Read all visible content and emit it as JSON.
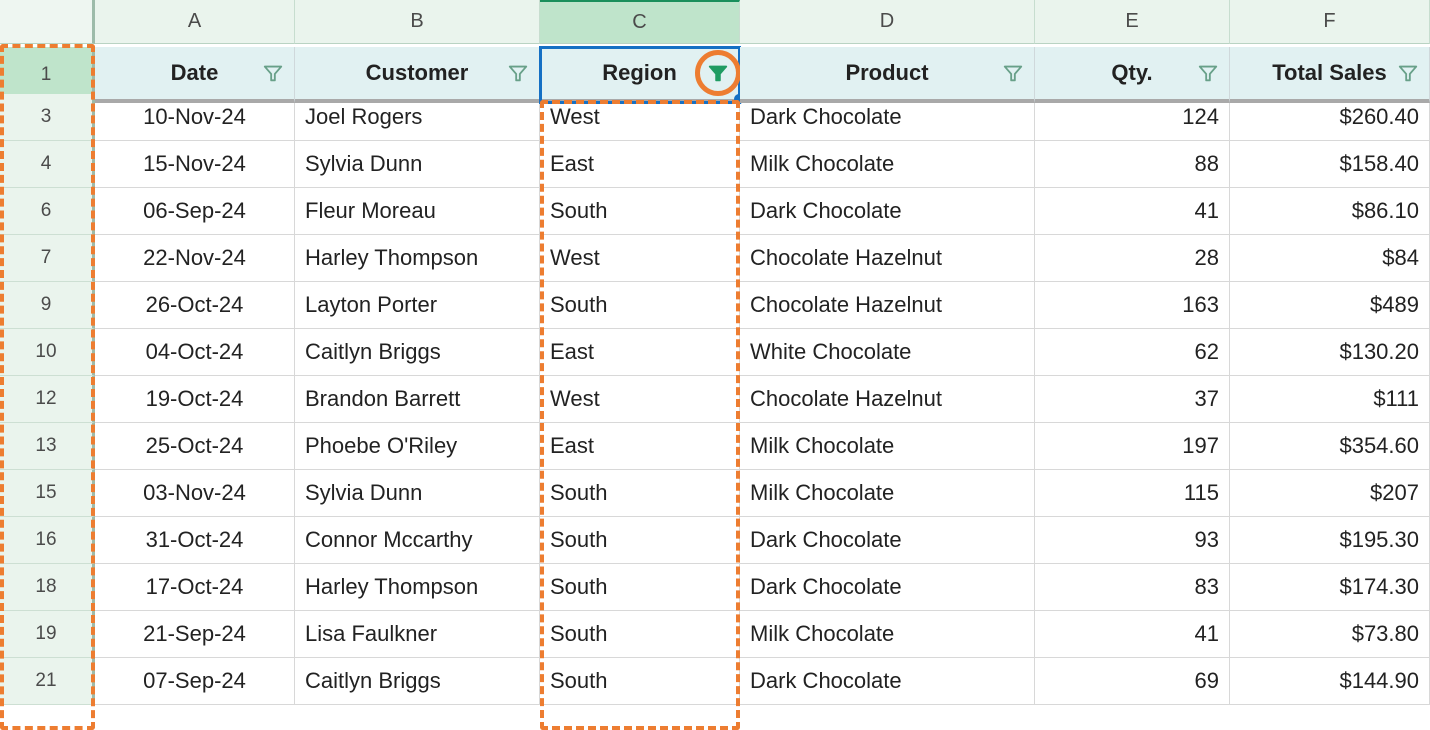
{
  "columns_letters": [
    "A",
    "B",
    "C",
    "D",
    "E",
    "F"
  ],
  "selected_column_index": 2,
  "selected_header": "Region",
  "row_numbers": [
    1,
    3,
    4,
    6,
    7,
    9,
    10,
    12,
    13,
    15,
    16,
    18,
    19,
    21
  ],
  "headers": [
    "Date",
    "Customer",
    "Region",
    "Product",
    "Qty.",
    "Total Sales"
  ],
  "active_filter_index": 2,
  "rows": [
    {
      "date": "10-Nov-24",
      "customer": "Joel Rogers",
      "region": "West",
      "product": "Dark Chocolate",
      "qty": "124",
      "total": "$260.40"
    },
    {
      "date": "15-Nov-24",
      "customer": "Sylvia Dunn",
      "region": "East",
      "product": "Milk Chocolate",
      "qty": "88",
      "total": "$158.40"
    },
    {
      "date": "06-Sep-24",
      "customer": "Fleur Moreau",
      "region": "South",
      "product": "Dark Chocolate",
      "qty": "41",
      "total": "$86.10"
    },
    {
      "date": "22-Nov-24",
      "customer": "Harley Thompson",
      "region": "West",
      "product": "Chocolate Hazelnut",
      "qty": "28",
      "total": "$84"
    },
    {
      "date": "26-Oct-24",
      "customer": "Layton Porter",
      "region": "South",
      "product": "Chocolate Hazelnut",
      "qty": "163",
      "total": "$489"
    },
    {
      "date": "04-Oct-24",
      "customer": "Caitlyn Briggs",
      "region": "East",
      "product": "White Chocolate",
      "qty": "62",
      "total": "$130.20"
    },
    {
      "date": "19-Oct-24",
      "customer": "Brandon Barrett",
      "region": "West",
      "product": "Chocolate Hazelnut",
      "qty": "37",
      "total": "$111"
    },
    {
      "date": "25-Oct-24",
      "customer": "Phoebe O'Riley",
      "region": "East",
      "product": "Milk Chocolate",
      "qty": "197",
      "total": "$354.60"
    },
    {
      "date": "03-Nov-24",
      "customer": "Sylvia Dunn",
      "region": "South",
      "product": "Milk Chocolate",
      "qty": "115",
      "total": "$207"
    },
    {
      "date": "31-Oct-24",
      "customer": "Connor Mccarthy",
      "region": "South",
      "product": "Dark Chocolate",
      "qty": "93",
      "total": "$195.30"
    },
    {
      "date": "17-Oct-24",
      "customer": "Harley Thompson",
      "region": "South",
      "product": "Dark Chocolate",
      "qty": "83",
      "total": "$174.30"
    },
    {
      "date": "21-Sep-24",
      "customer": "Lisa Faulkner",
      "region": "South",
      "product": "Milk Chocolate",
      "qty": "41",
      "total": "$73.80"
    },
    {
      "date": "07-Sep-24",
      "customer": "Caitlyn Briggs",
      "region": "South",
      "product": "Dark Chocolate",
      "qty": "69",
      "total": "$144.90"
    }
  ],
  "colors": {
    "highlight_border": "#ed7d31",
    "selection": "#1570c4",
    "filter_active": "#1f9c63"
  }
}
